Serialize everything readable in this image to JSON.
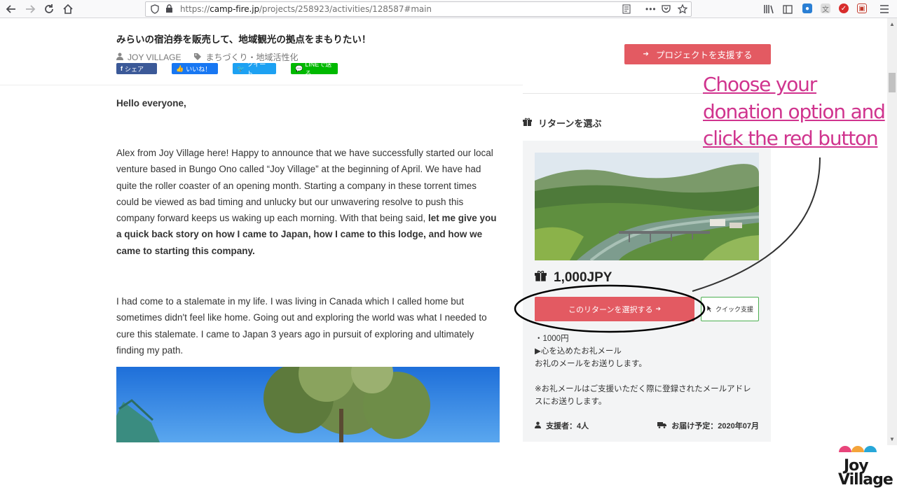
{
  "browser": {
    "url_prefix": "https://",
    "url_domain": "camp-fire.jp",
    "url_path": "/projects/258923/activities/128587#main"
  },
  "project": {
    "title": "みらいの宿泊券を販売して、地域観光の拠点をまもりたい！",
    "owner": "JOY VILLAGE",
    "category": "まちづくり・地域活性化",
    "share_buttons": [
      "シェア",
      "いいね！",
      "ツイート",
      "LINEで送る"
    ]
  },
  "article": {
    "greeting": "Hello everyone,",
    "para1_normal": "Alex from Joy Village here! Happy to announce that we have successfully started our local venture based in Bungo Ono called “Joy Village” at the beginning of April. We have had quite the roller coaster of an opening month. Starting a company in these torrent times could be viewed as bad timing and unlucky but our unwavering resolve to push this company forward keeps us waking up each morning. With that being said, ",
    "para1_bold": "let me give you a quick back story on how I came to Japan, how I came to this lodge, and how we came to starting this company.",
    "para2": "I had come to a stalemate in my life. I was living in Canada which I called home but sometimes didn't feel like home. Going out and exploring the world was what I needed to cure this stalemate. I came to Japan 3 years ago in pursuit of exploring and ultimately finding my path."
  },
  "sidebar": {
    "support_button": "プロジェクトを支援する",
    "returns_heading": "リターンを選ぶ",
    "return": {
      "price": "1,000JPY",
      "select_button": "このリターンを選択する",
      "quick_button": "クイック支援",
      "desc_lines": [
        "・1000円",
        "▶心を込めたお礼メール",
        "お礼のメールをお送りします。",
        "",
        "※お礼メールはご支援いただく際に登録されたメールアドレスにお送りします。"
      ],
      "supporters": "支援者：4人",
      "delivery": "お届け予定：2020年07月"
    }
  },
  "annotation": {
    "lines": [
      "Choose your",
      "donation option and",
      "click the red button"
    ],
    "color": "#d0348e"
  },
  "logo": {
    "line1": "Joy",
    "line2": "Village"
  },
  "colors": {
    "cta_red": "#e35a62",
    "facebook": "#3b5998",
    "like": "#1877f2",
    "twitter": "#1da1f2",
    "line": "#00b900"
  }
}
